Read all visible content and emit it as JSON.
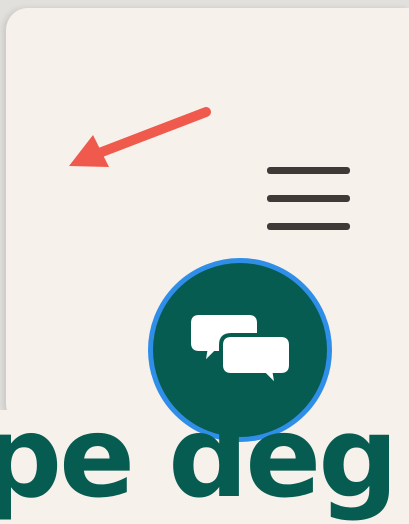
{
  "page": {
    "heading_fragment": "pe deg"
  },
  "icons": {
    "arrow": "arrow-pointing-up-left",
    "menu": "hamburger-menu-icon",
    "chat": "chat-bubbles-icon"
  },
  "colors": {
    "background": "#f6f1ea",
    "accent": "#075c52",
    "chat_border": "#2f8ee8",
    "arrow": "#ef5a4c",
    "menu_bars": "#3f3a37"
  }
}
